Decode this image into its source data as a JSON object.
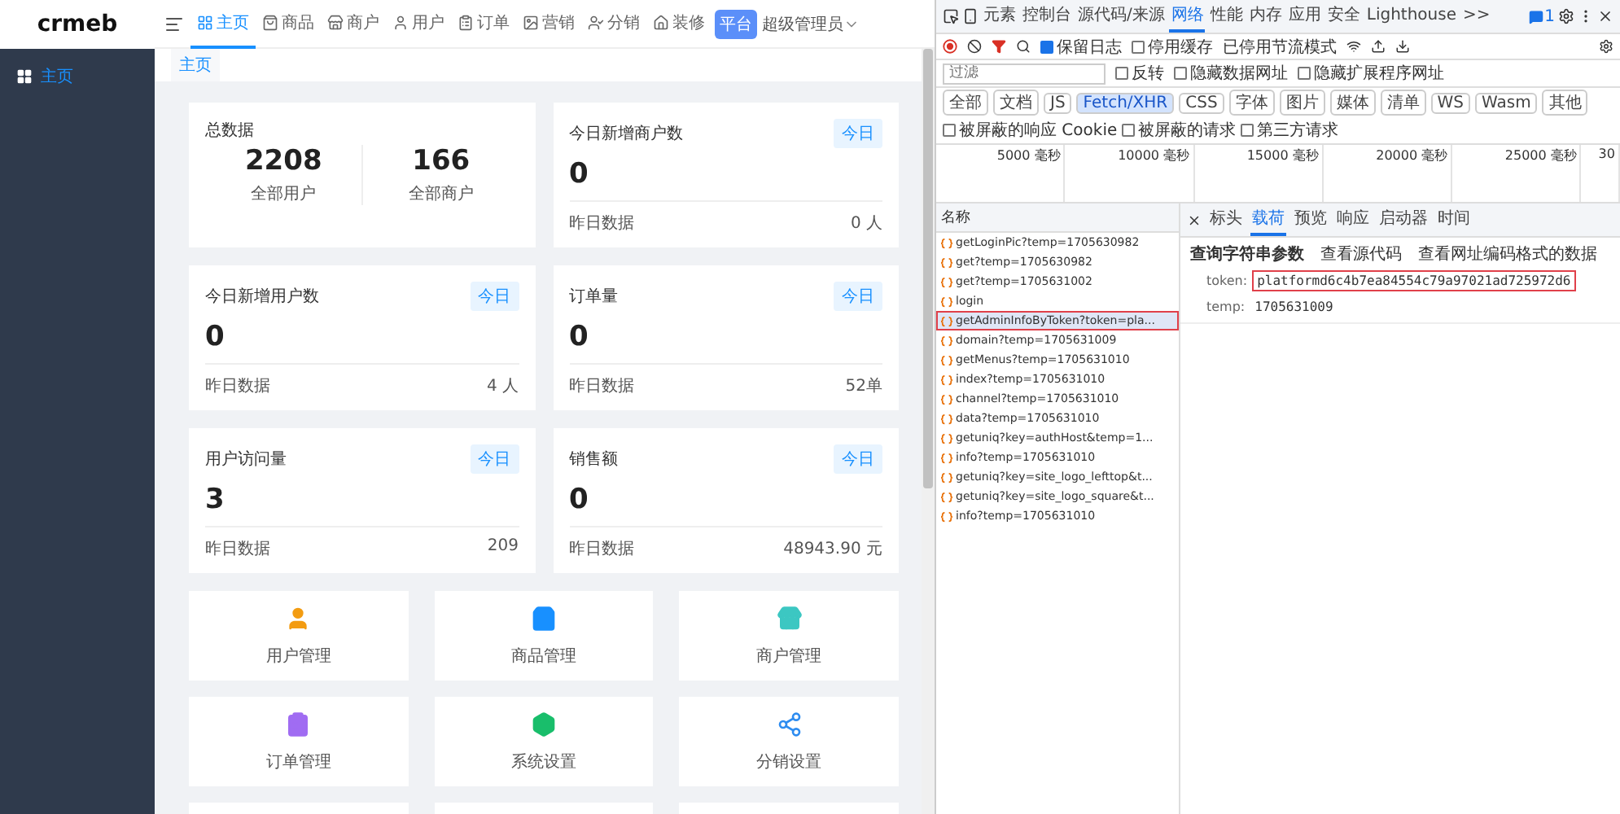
{
  "app": {
    "logo": "crmeb",
    "nav": [
      {
        "label": "主页",
        "selected": true
      },
      {
        "label": "商品",
        "selected": false
      },
      {
        "label": "商户",
        "selected": false
      },
      {
        "label": "用户",
        "selected": false
      },
      {
        "label": "订单",
        "selected": false
      },
      {
        "label": "营销",
        "selected": false
      },
      {
        "label": "分销",
        "selected": false
      },
      {
        "label": "装修",
        "selected": false
      }
    ],
    "platform_badge": "平台",
    "user": "超级管理员",
    "sidebar": [
      {
        "label": "主页",
        "selected": true
      }
    ],
    "tags": [
      {
        "label": "主页",
        "selected": true
      }
    ],
    "total_card": {
      "title": "总数据",
      "stats": [
        {
          "value": "2208",
          "label": "全部用户"
        },
        {
          "value": "166",
          "label": "全部商户"
        }
      ]
    },
    "stat_cards": [
      {
        "title": "今日新增商户数",
        "badge": "今日",
        "value": "0",
        "footer_label": "昨日数据",
        "footer_value": "0 人"
      },
      {
        "title": "今日新增用户数",
        "badge": "今日",
        "value": "0",
        "footer_label": "昨日数据",
        "footer_value": "4 人"
      },
      {
        "title": "订单量",
        "badge": "今日",
        "value": "0",
        "footer_label": "昨日数据",
        "footer_value": "52单"
      },
      {
        "title": "用户访问量",
        "badge": "今日",
        "value": "3",
        "footer_label": "昨日数据",
        "footer_value": "209"
      },
      {
        "title": "销售额",
        "badge": "今日",
        "value": "0",
        "footer_label": "昨日数据",
        "footer_value": "48943.90 元"
      }
    ],
    "quick_menu": [
      "用户管理",
      "商品管理",
      "商户管理",
      "订单管理",
      "系统设置",
      "分销设置"
    ]
  },
  "devtools": {
    "tabs": [
      {
        "label": "元素",
        "selected": false
      },
      {
        "label": "控制台",
        "selected": false
      },
      {
        "label": "源代码/来源",
        "selected": false
      },
      {
        "label": "网络",
        "selected": true
      },
      {
        "label": "性能",
        "selected": false
      },
      {
        "label": "内存",
        "selected": false
      },
      {
        "label": "应用",
        "selected": false
      },
      {
        "label": "安全",
        "selected": false
      },
      {
        "label": "Lighthouse",
        "selected": false
      }
    ],
    "more": ">>",
    "issues_count": "1",
    "toolbar": {
      "preserve_log": {
        "label": "保留日志",
        "checked": true
      },
      "disable_cache": {
        "label": "停用缓存",
        "checked": false
      },
      "throttle": "已停用节流模式"
    },
    "filter": {
      "placeholder": "过滤",
      "options": [
        {
          "label": "反转",
          "checked": false
        },
        {
          "label": "隐藏数据网址",
          "checked": false
        },
        {
          "label": "隐藏扩展程序网址",
          "checked": false
        }
      ]
    },
    "types": [
      {
        "label": "全部",
        "selected": false
      },
      {
        "label": "文档",
        "selected": false
      },
      {
        "label": "JS",
        "selected": false
      },
      {
        "label": "Fetch/XHR",
        "selected": true
      },
      {
        "label": "CSS",
        "selected": false
      },
      {
        "label": "字体",
        "selected": false
      },
      {
        "label": "图片",
        "selected": false
      },
      {
        "label": "媒体",
        "selected": false
      },
      {
        "label": "清单",
        "selected": false
      },
      {
        "label": "WS",
        "selected": false
      },
      {
        "label": "Wasm",
        "selected": false
      },
      {
        "label": "其他",
        "selected": false
      }
    ],
    "type_options": [
      {
        "label": "被屏蔽的响应 Cookie",
        "checked": false
      },
      {
        "label": "被屏蔽的请求",
        "checked": false
      },
      {
        "label": "第三方请求",
        "checked": false
      }
    ],
    "timeline_ticks": [
      "5000 毫秒",
      "10000 毫秒",
      "15000 毫秒",
      "20000 毫秒",
      "25000 毫秒",
      "30"
    ],
    "list_header": "名称",
    "requests": [
      {
        "name": "getLoginPic?temp=1705630982",
        "selected": false
      },
      {
        "name": "get?temp=1705630982",
        "selected": false
      },
      {
        "name": "get?temp=1705631002",
        "selected": false
      },
      {
        "name": "login",
        "selected": false
      },
      {
        "name": "getAdminInfoByToken?token=pla...",
        "selected": true
      },
      {
        "name": "domain?temp=1705631009",
        "selected": false
      },
      {
        "name": "getMenus?temp=1705631010",
        "selected": false
      },
      {
        "name": "index?temp=1705631010",
        "selected": false
      },
      {
        "name": "channel?temp=1705631010",
        "selected": false
      },
      {
        "name": "data?temp=1705631010",
        "selected": false
      },
      {
        "name": "getuniq?key=authHost&temp=1...",
        "selected": false
      },
      {
        "name": "info?temp=1705631010",
        "selected": false
      },
      {
        "name": "getuniq?key=site_logo_lefttop&t...",
        "selected": false
      },
      {
        "name": "getuniq?key=site_logo_square&t...",
        "selected": false
      },
      {
        "name": "info?temp=1705631010",
        "selected": false
      }
    ],
    "detail_tabs": [
      {
        "label": "标头",
        "selected": false
      },
      {
        "label": "载荷",
        "selected": true
      },
      {
        "label": "预览",
        "selected": false
      },
      {
        "label": "响应",
        "selected": false
      },
      {
        "label": "启动器",
        "selected": false
      },
      {
        "label": "时间",
        "selected": false
      }
    ],
    "payload": {
      "section": "查询字符串参数",
      "links": [
        "查看源代码",
        "查看网址编码格式的数据"
      ],
      "params": [
        {
          "key": "token:",
          "value": "platformd6c4b7ea84554c79a97021ad725972d6",
          "highlighted": true
        },
        {
          "key": "temp:",
          "value": "1705631009",
          "highlighted": false
        }
      ]
    }
  }
}
